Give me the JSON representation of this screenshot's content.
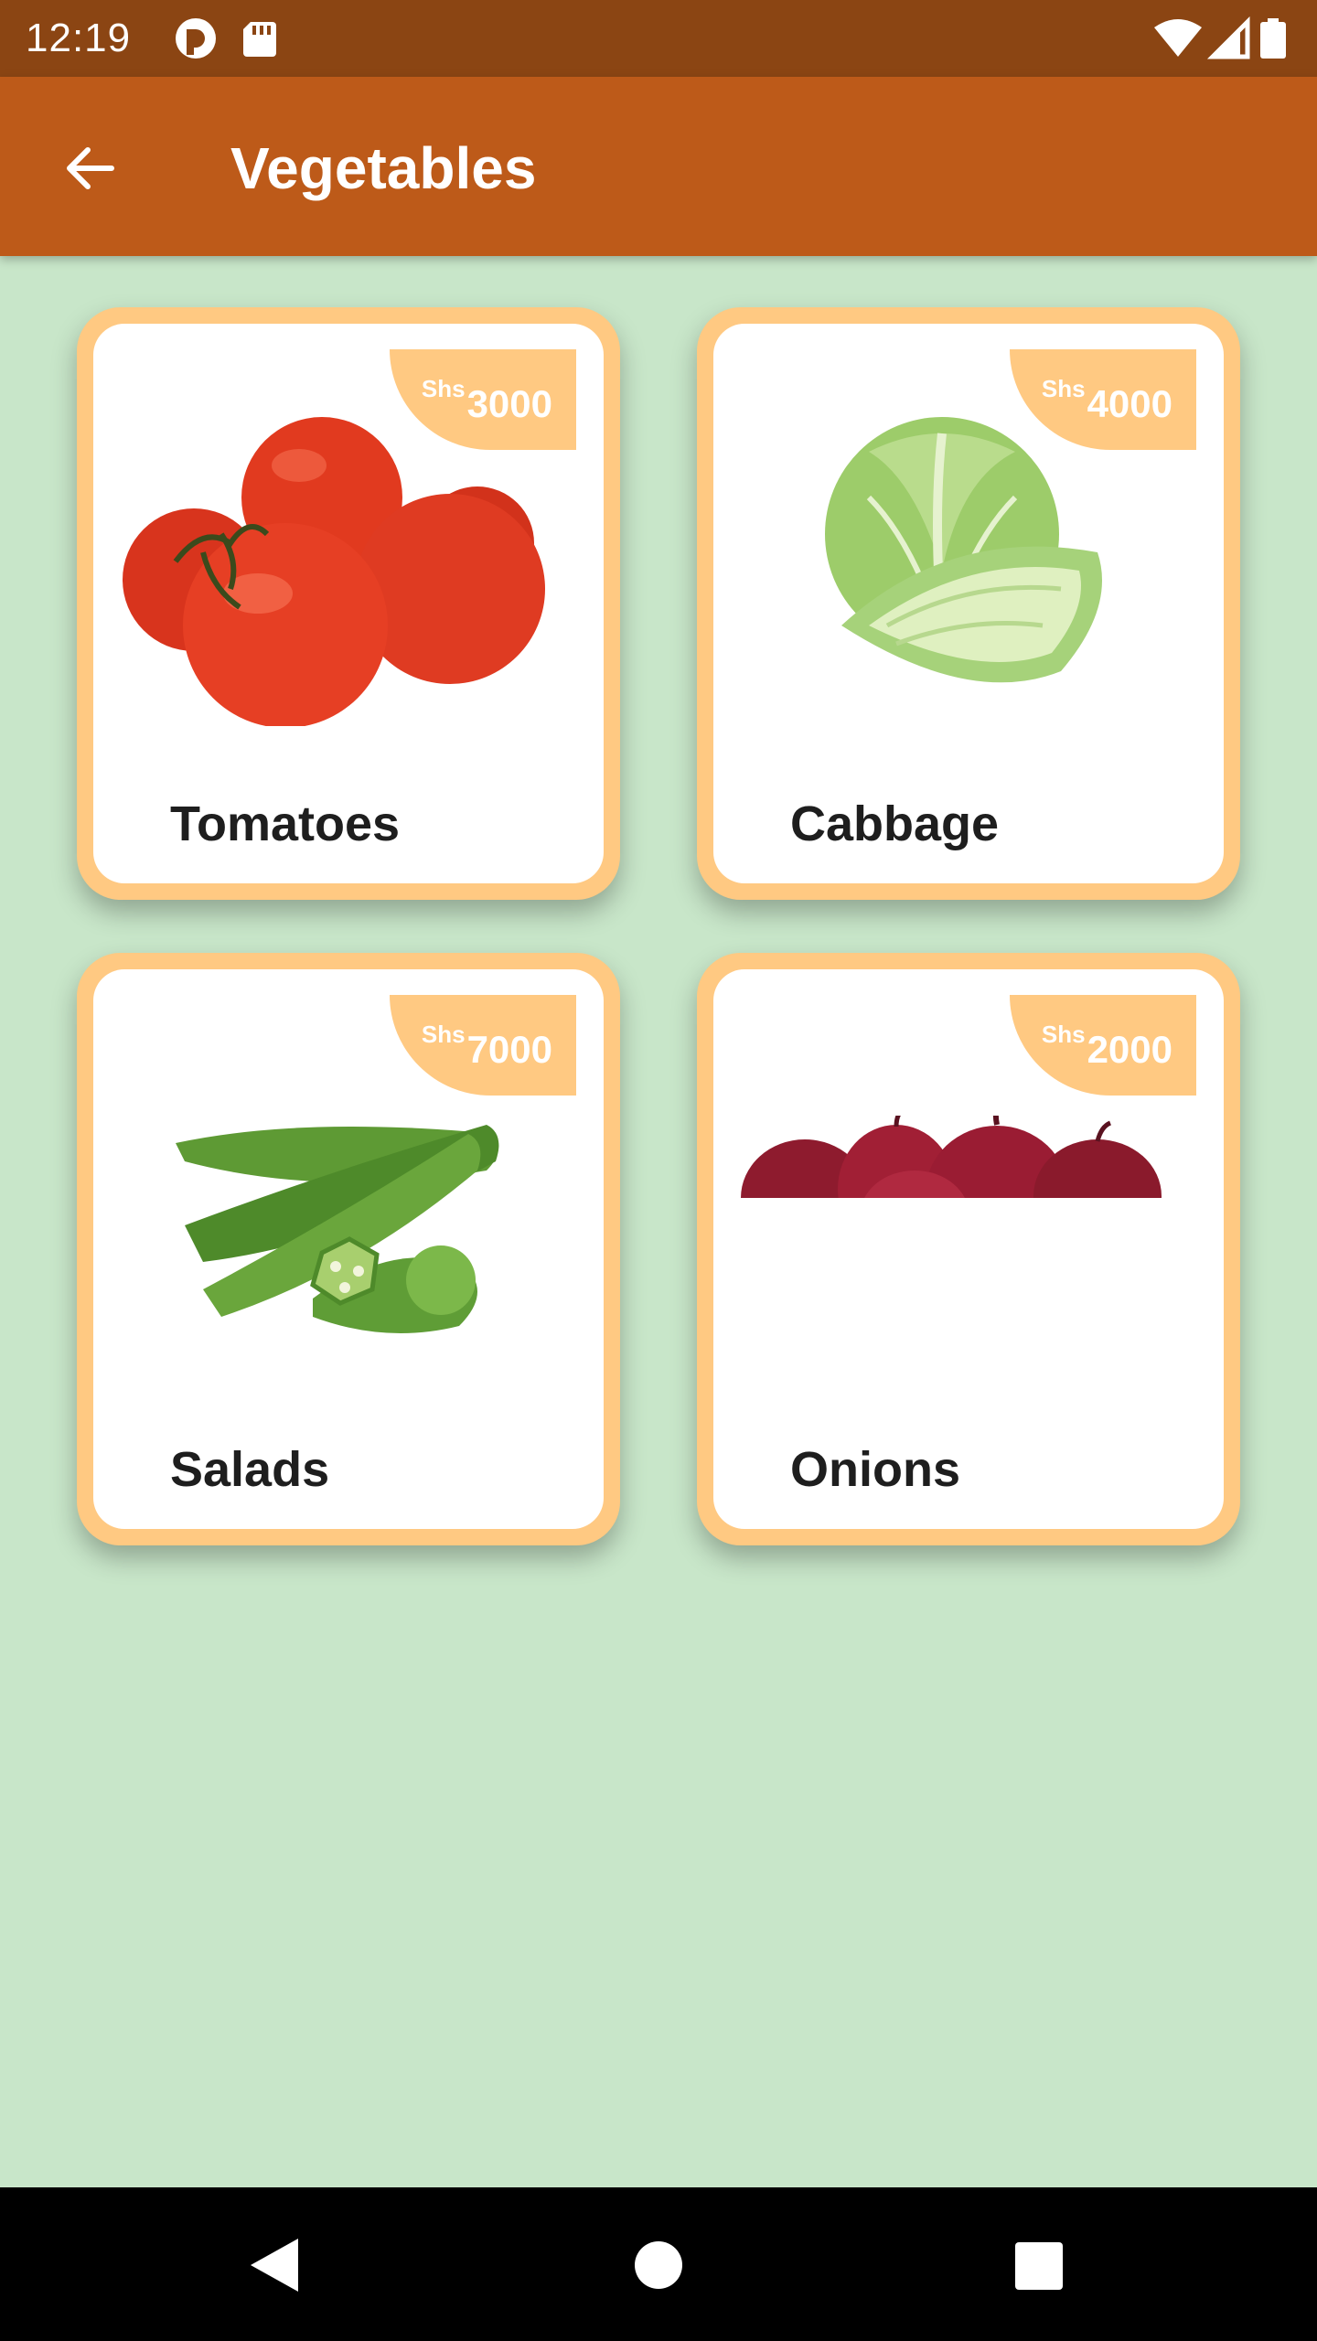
{
  "status_bar": {
    "time": "12:19",
    "left_icons": [
      "notification-app-icon",
      "sd-card-icon"
    ],
    "right_icons": [
      "wifi-icon",
      "signal-icon",
      "battery-icon"
    ]
  },
  "app_bar": {
    "title": "Vegetables",
    "back_icon": "arrow-left-icon"
  },
  "products": [
    {
      "name": "Tomatoes",
      "currency": "Shs",
      "price": "3000",
      "image": "tomatoes-image"
    },
    {
      "name": "Cabbage",
      "currency": "Shs",
      "price": "4000",
      "image": "cabbage-image"
    },
    {
      "name": "Salads",
      "currency": "Shs",
      "price": "7000",
      "image": "okra-image"
    },
    {
      "name": "Onions",
      "currency": "Shs",
      "price": "2000",
      "image": "onions-image"
    }
  ],
  "colors": {
    "status_bar": "#8b4513",
    "app_bar": "#bd5a19",
    "background": "#c8e6c9",
    "card_border": "#ffc982",
    "card_surface": "#ffffff"
  },
  "nav_bar": {
    "buttons": [
      "back-triangle-icon",
      "home-circle-icon",
      "recents-square-icon"
    ]
  }
}
